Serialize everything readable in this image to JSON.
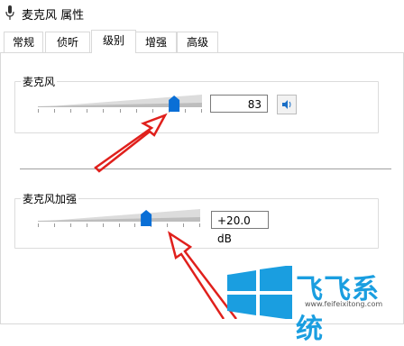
{
  "window": {
    "title": "麦克风 属性"
  },
  "tabs": [
    {
      "label": "常规"
    },
    {
      "label": "侦听"
    },
    {
      "label": "级别",
      "active": true
    },
    {
      "label": "增强"
    },
    {
      "label": "高级"
    }
  ],
  "microphone": {
    "label": "麦克风",
    "value": "83",
    "level": 0.83
  },
  "boost": {
    "label": "麦克风加强",
    "value": "+20.0 dB",
    "level": 0.667
  },
  "watermark": {
    "brand": "飞飞系统",
    "url": "www.feifeixitong.com"
  },
  "colors": {
    "thumb": "#0a6fd6",
    "arrow": "#e0201c",
    "logo": "#1a9ee0"
  },
  "icons": {
    "speaker": "speaker-icon",
    "mic": "microphone-icon",
    "windows": "windows-logo-icon"
  }
}
